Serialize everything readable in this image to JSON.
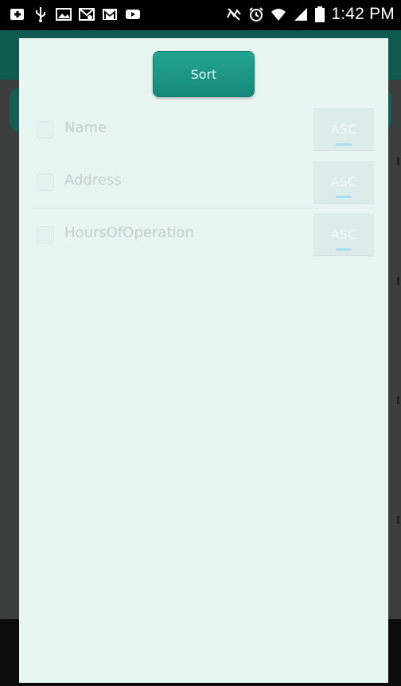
{
  "status_bar": {
    "time": "1:42 PM",
    "left_icons": [
      "add-icon",
      "usb-icon",
      "image-icon",
      "voicemail-icon",
      "gmail-icon",
      "youtube-icon"
    ],
    "right_icons": [
      "mute-icon",
      "alarm-icon",
      "wifi-icon",
      "signal-icon",
      "battery-icon"
    ]
  },
  "dialog": {
    "sort_label": "Sort",
    "rows": [
      {
        "label": "Name",
        "order": "ASC",
        "checked": false
      },
      {
        "label": "Address",
        "order": "ASC",
        "checked": false
      },
      {
        "label": "HoursOfOperation",
        "order": "ASC",
        "checked": false
      }
    ]
  },
  "colors": {
    "accent": "#1a9886",
    "dialog_bg": "#e8f6f2",
    "status_bar": "#000000"
  }
}
